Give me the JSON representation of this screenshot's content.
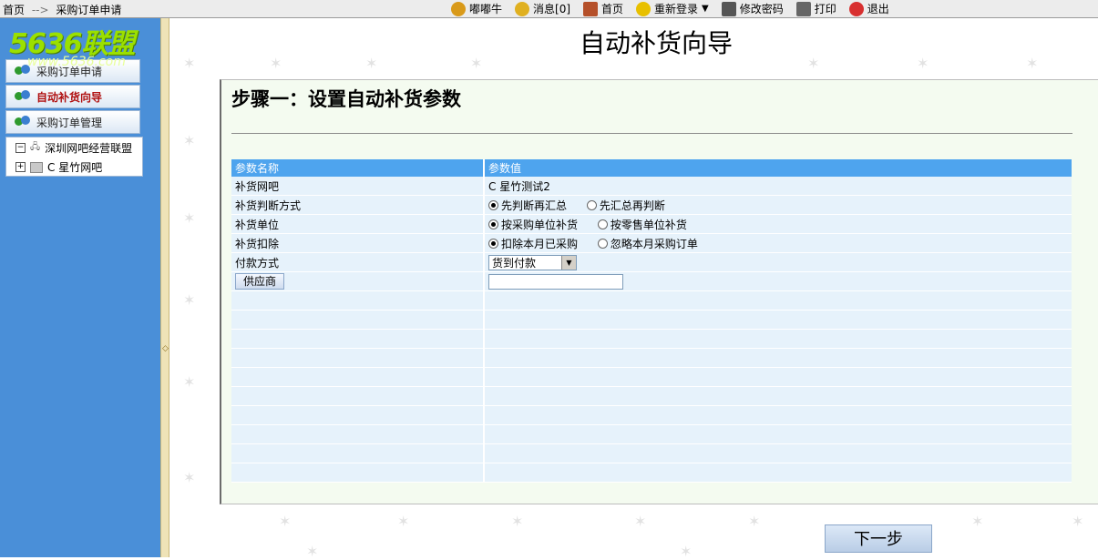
{
  "breadcrumb": {
    "home": "首页",
    "separator": "-->",
    "current": "采购订单申请"
  },
  "toolbar": {
    "items": [
      {
        "label": "嘟嘟牛",
        "icon": "cow-icon",
        "color": "#d99a1a"
      },
      {
        "label": "消息[0]",
        "icon": "message-icon",
        "color": "#e0b020"
      },
      {
        "label": "首页",
        "icon": "home-icon",
        "color": "#b5502a"
      },
      {
        "label": "重新登录",
        "icon": "relogin-icon",
        "color": "#e8c000"
      },
      {
        "label": "修改密码",
        "icon": "password-icon",
        "color": "#555555"
      },
      {
        "label": "打印",
        "icon": "print-icon",
        "color": "#666666"
      },
      {
        "label": "退出",
        "icon": "exit-icon",
        "color": "#d83030"
      }
    ]
  },
  "logo": {
    "text": "5636联盟",
    "url": "www.5636.com"
  },
  "sidebar": {
    "items": [
      {
        "label": "采购订单申请",
        "active": false
      },
      {
        "label": "自动补货向导",
        "active": true
      },
      {
        "label": "采购订单管理",
        "active": false
      }
    ],
    "tree": {
      "root": "深圳网吧经营联盟",
      "child": "C 星竹网吧"
    }
  },
  "main": {
    "title": "自动补货向导",
    "step_title": "步骤一：设置自动补货参数",
    "table": {
      "headers": [
        "参数名称",
        "参数值"
      ],
      "rows": [
        {
          "name": "补货网吧",
          "value": "C 星竹测试2"
        },
        {
          "name": "补货判断方式",
          "options": [
            "先判断再汇总",
            "先汇总再判断"
          ],
          "selected": 0
        },
        {
          "name": "补货单位",
          "options": [
            "按采购单位补货",
            "按零售单位补货"
          ],
          "selected": 0
        },
        {
          "name": "补货扣除",
          "options": [
            "扣除本月已采购",
            "忽略本月采购订单"
          ],
          "selected": 0
        },
        {
          "name": "付款方式",
          "select_value": "货到付款"
        },
        {
          "name": "供应商",
          "input_value": ""
        }
      ]
    },
    "next_button": "下一步"
  },
  "colors": {
    "sidebar_bg": "#4a8fd8",
    "table_header": "#4ea4ee",
    "panel_bg": "#f4fbf0",
    "active_menu": "#b01010"
  }
}
